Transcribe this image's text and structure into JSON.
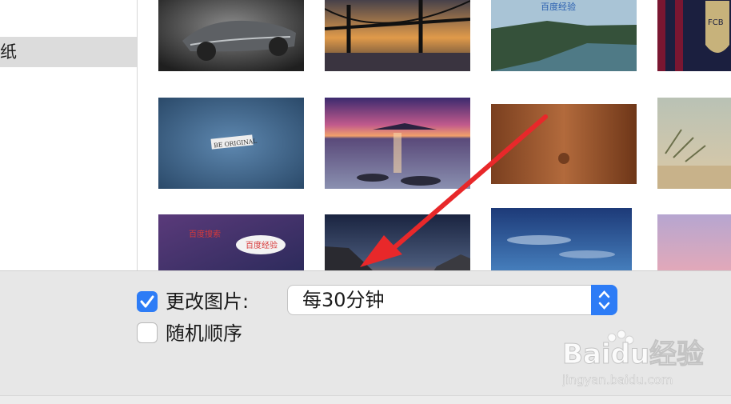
{
  "sidebar": {
    "selected_item": "纸"
  },
  "wallpapers": [
    {
      "icon": "car-wallpaper"
    },
    {
      "icon": "bridge-sunset-wallpaper"
    },
    {
      "icon": "cliffs-sea-wallpaper",
      "overlay_text": "百度经验"
    },
    {
      "icon": "barcelona-wallpaper",
      "overlay_text": "FCB"
    },
    {
      "icon": "be-original-wallpaper",
      "overlay_text": "BE ORIGINAL"
    },
    {
      "icon": "purple-sunset-sea-wallpaper"
    },
    {
      "icon": "wood-apple-wallpaper"
    },
    {
      "icon": "beach-grass-wallpaper"
    },
    {
      "icon": "galaxy-wallpaper",
      "overlay_text": "百度搜索",
      "bubble_text": "百度经验"
    },
    {
      "icon": "night-coast-wallpaper"
    },
    {
      "icon": "blue-sky-wallpaper"
    },
    {
      "icon": "pink-sky-wallpaper"
    }
  ],
  "controls": {
    "change_picture_label": "更改图片:",
    "change_picture_checked": true,
    "interval_value": "每30分钟",
    "random_order_label": "随机顺序",
    "random_order_checked": false
  },
  "watermark": {
    "brand": "Baidu经验",
    "url": "jingyan.baidu.com"
  },
  "colors": {
    "accent": "#2d7cf6",
    "arrow": "#e8282a",
    "bar": "#e7e7e7"
  }
}
